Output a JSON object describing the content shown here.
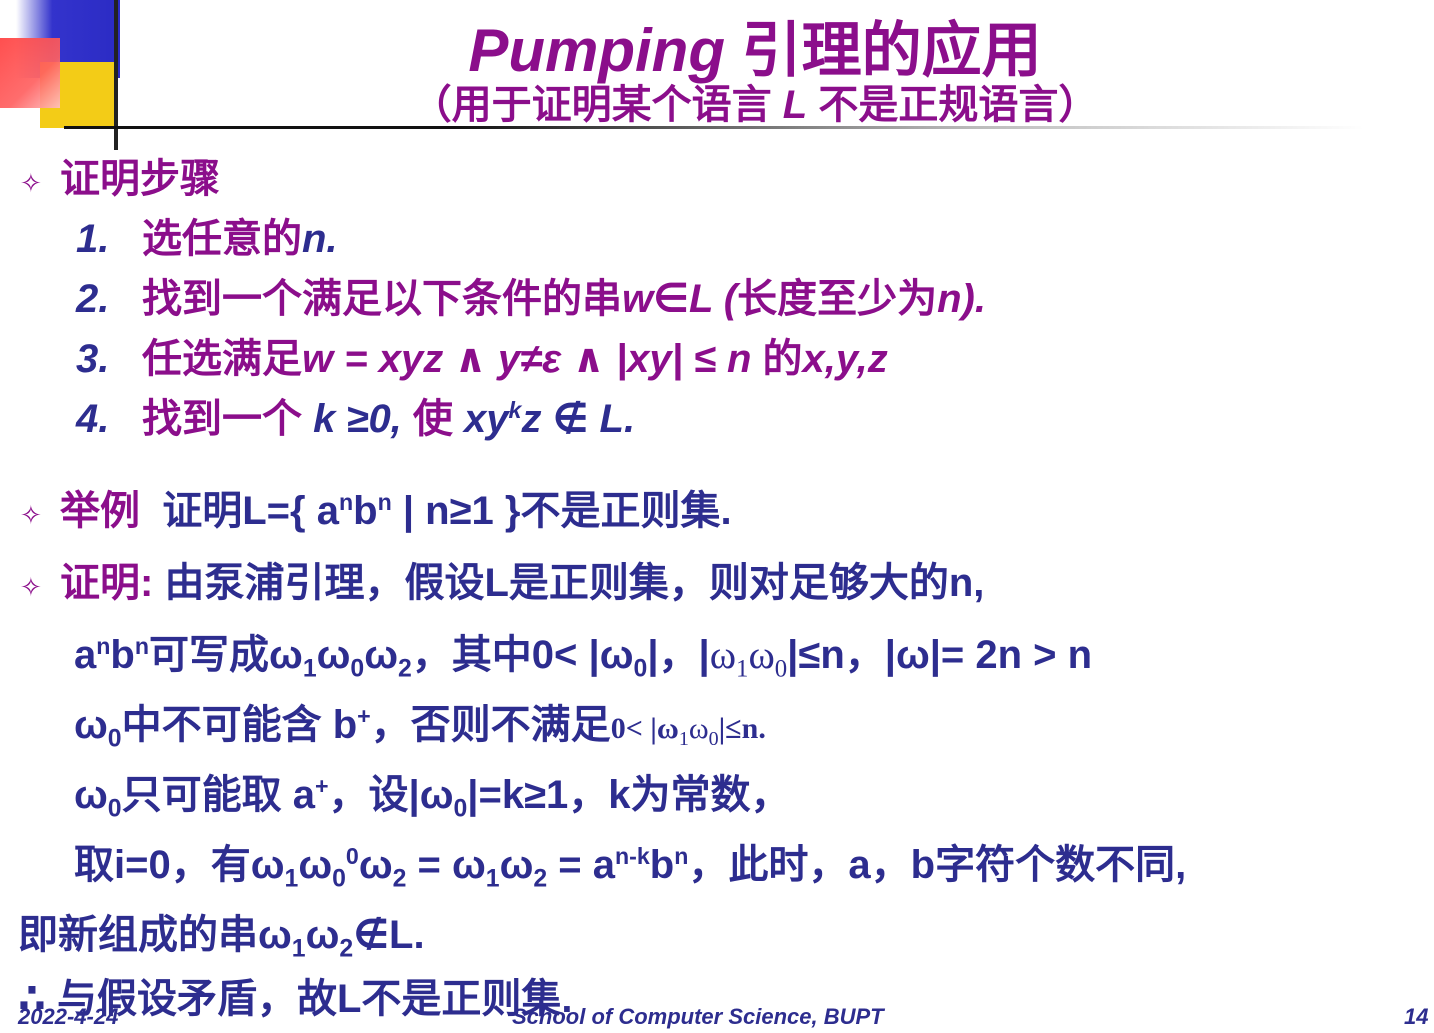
{
  "title": {
    "prefix": "Pumping",
    "rest": " 引理的应用"
  },
  "subtitle": {
    "open": "（用于证明某个语言 ",
    "var": "L",
    "close": " 不是正规语言）"
  },
  "section_proof_steps": "证明步骤",
  "steps": [
    {
      "num": "1.",
      "text": "选任意的",
      "tail": "n."
    },
    {
      "num": "2.",
      "text": "找到一个满足以下条件的串",
      "tail": "w∈L (",
      "tail2": "长度至少为",
      "tail3": "n)."
    },
    {
      "num": "3.",
      "text": "任选满足",
      "tail": "w = xyz ∧ y≠ε  ∧ |xy| ≤ n ",
      "tail2": "的",
      "tail3": "x,y,z"
    },
    {
      "num": "4.",
      "text": "找到一个 ",
      "tail": "k ≥0,  ",
      "tail2": "使 ",
      "tail3": "xy",
      "sup": "k",
      "tail4": "z ∉ L."
    }
  ],
  "example": {
    "label": "举例",
    "text_a": "证明L={ a",
    "sup1": "n",
    "text_b": "b",
    "sup2": "n",
    "text_c": " | n≥1 }不是正则集."
  },
  "proof": {
    "label": "证明:",
    "line1": " 由泵浦引理，假设L是正则集，则对足够大的n,",
    "line2": {
      "a": "a",
      "sup1": "n",
      "b": "b",
      "sup2": "n",
      "c": "可写成ω",
      "s1": "1",
      "d": "ω",
      "s2": "0",
      "e": "ω",
      "s3": "2",
      "f": "，其中0< |ω",
      "s4": "0",
      "g": "|，|",
      "h": "ω",
      "s5": "1",
      "i": "ω",
      "s6": "0",
      "j": "|≤n，|ω|= 2n > n"
    },
    "line3": {
      "a": "ω",
      "s1": "0",
      "b": "中不可能含 b",
      "sup": "+",
      "c": "，否则不满足",
      "d": "0< |ω",
      "s2": "1",
      "e": "ω",
      "s3": "0",
      "f": "|≤n."
    },
    "line4": {
      "a": "ω",
      "s1": "0",
      "b": "只可能取 a",
      "sup": "+",
      "c": "，设|ω",
      "s2": "0",
      "d": "|=k≥1，k为常数，"
    },
    "line5": {
      "a": "取i=0，有ω",
      "s1": "1",
      "b": "ω",
      "s2": "0",
      "sup1": "0",
      "c": "ω",
      "s3": "2",
      "d": " = ω",
      "s4": "1",
      "e": "ω",
      "s5": "2",
      "f": " = a",
      "sup2": "n-k",
      "g": "b",
      "sup3": "n",
      "h": "，此时，a，b字符个数不同,"
    },
    "line6": {
      "a": "即新组成的串ω",
      "s1": "1",
      "b": "ω",
      "s2": "2",
      "c": "∉L."
    },
    "line7": {
      "a": "∴    与假设矛盾，故L不是正则集."
    }
  },
  "footer": {
    "date": "2022-4-24",
    "school": "School of Computer Science, BUPT",
    "page": "14"
  },
  "colors": {
    "purple": "#8b0e8b",
    "navy": "#2d2d8f"
  }
}
